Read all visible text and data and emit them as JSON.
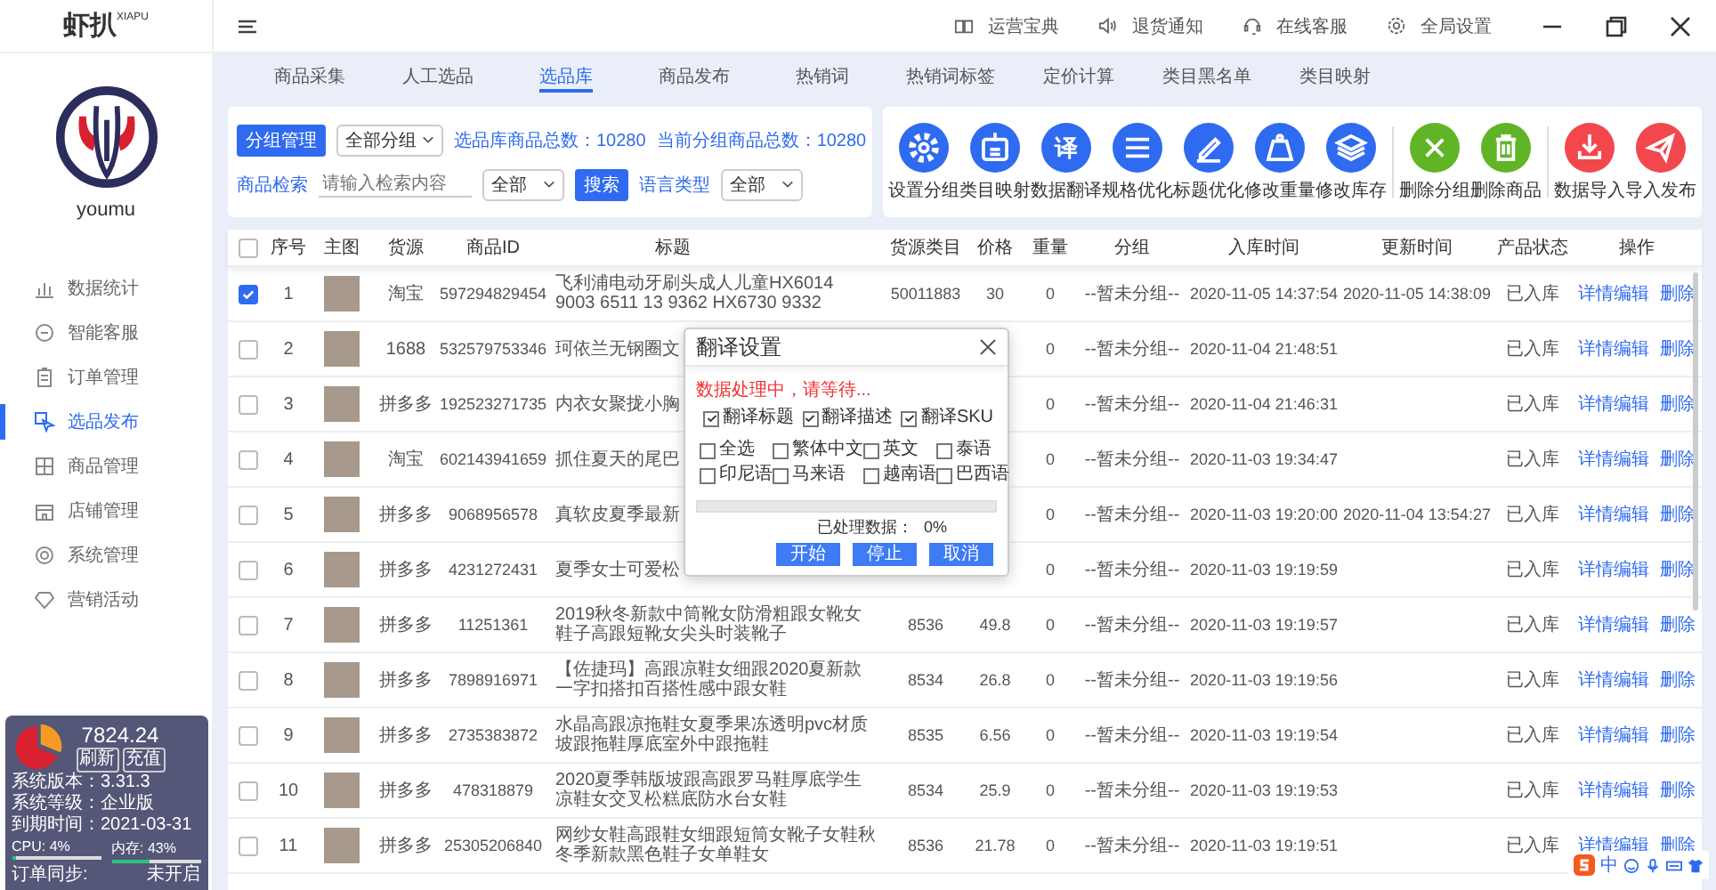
{
  "app": {
    "logo": "虾扒",
    "logo_sup": "XIAPU"
  },
  "header": {
    "links": [
      "运营宝典",
      "退货通知",
      "在线客服",
      "全局设置"
    ]
  },
  "user": {
    "name": "youmu"
  },
  "sidebar": {
    "items": [
      {
        "label": "数据统计",
        "selected": false
      },
      {
        "label": "智能客服",
        "selected": false
      },
      {
        "label": "订单管理",
        "selected": false
      },
      {
        "label": "选品发布",
        "selected": true
      },
      {
        "label": "商品管理",
        "selected": false
      },
      {
        "label": "店铺管理",
        "selected": false
      },
      {
        "label": "系统管理",
        "selected": false
      },
      {
        "label": "营销活动",
        "selected": false
      }
    ]
  },
  "account": {
    "balance": "7824.24",
    "buttons": [
      "刷新",
      "充值"
    ],
    "info": [
      {
        "label": "系统版本",
        "colon": "：",
        "value": "3.31.3"
      },
      {
        "label": "系统等级",
        "colon": "：",
        "value": "企业版"
      },
      {
        "label": "到期时间",
        "colon": "：",
        "value": "2021-03-31"
      }
    ],
    "meters": [
      {
        "label": "CPU: 4%",
        "level": 0.04
      },
      {
        "label": "内存: 43%",
        "level": 0.43
      }
    ],
    "sync": {
      "label": "订单同步:",
      "value": "未开启"
    }
  },
  "tabs": [
    {
      "label": "商品采集",
      "selected": false
    },
    {
      "label": "人工选品",
      "selected": false
    },
    {
      "label": "选品库",
      "selected": true
    },
    {
      "label": "商品发布",
      "selected": false
    },
    {
      "label": "热销词",
      "selected": false
    },
    {
      "label": "热销词标签",
      "selected": false
    },
    {
      "label": "定价计算",
      "selected": false
    },
    {
      "label": "类目黑名单",
      "selected": false
    },
    {
      "label": "类目映射",
      "selected": false
    }
  ],
  "filters": {
    "group_button": "分组管理",
    "group_select": "全部分组",
    "total": "选品库商品总数：10280",
    "group_total": "当前分组商品总数：10280",
    "search_label": "商品检索",
    "search_placeholder": "请输入检索内容",
    "scope_select": "全部",
    "search_button": "搜索",
    "language_label": "语言类型",
    "language_select": "全部"
  },
  "toolbar": {
    "groups": [
      {
        "kind": "edit",
        "tools": [
          {
            "label": "设置分组"
          },
          {
            "label": "类目映射"
          },
          {
            "glyph": "译",
            "label": "数据翻译"
          },
          {
            "label": "规格优化"
          },
          {
            "label": "标题优化"
          },
          {
            "label": "修改重量"
          },
          {
            "label": "修改库存"
          }
        ]
      },
      {
        "kind": "remove",
        "tools": [
          {
            "label": "删除分组"
          },
          {
            "label": "删除商品"
          }
        ]
      },
      {
        "kind": "transfer",
        "tools": [
          {
            "label": "数据导入"
          },
          {
            "label": "导入发布"
          }
        ]
      }
    ]
  },
  "table": {
    "select_all": {
      "checked": false
    },
    "columns": [
      "序号",
      "主图",
      "货源",
      "商品ID",
      "标题",
      "货源类目",
      "价格",
      "重量",
      "分组",
      "入库时间",
      "更新时间",
      "产品状态",
      "操作"
    ],
    "rows": [
      {
        "selected": true,
        "no": "1",
        "source": "淘宝",
        "id": "597294829454",
        "title": "飞利浦电动牙刷头成人儿童HX6014 9003 6511 13 9362 HX6730 9332",
        "category": "50011883",
        "price": "30",
        "weight": "0",
        "group": "--暂未分组--",
        "added": "2020-11-05 14:37:54",
        "updated": "2020-11-05 14:38:09",
        "status": "已入库",
        "actions": [
          "详情编辑",
          "删除"
        ]
      },
      {
        "selected": false,
        "no": "2",
        "source": "1688",
        "id": "532579753346",
        "title": "珂依兰无钢圈文",
        "weight": "0",
        "group": "--暂未分组--",
        "added": "2020-11-04 21:48:51",
        "status": "已入库",
        "actions": [
          "详情编辑",
          "删除"
        ]
      },
      {
        "selected": false,
        "no": "3",
        "source": "拼多多",
        "id": "192523271735",
        "title": "内衣女聚拢小胸",
        "weight": "0",
        "group": "--暂未分组--",
        "added": "2020-11-04 21:46:31",
        "status": "已入库",
        "actions": [
          "详情编辑",
          "删除"
        ]
      },
      {
        "selected": false,
        "no": "4",
        "source": "淘宝",
        "id": "602143941659",
        "title": "抓住夏天的尾巴",
        "weight": "0",
        "group": "--暂未分组--",
        "added": "2020-11-03 19:34:47",
        "status": "已入库",
        "actions": [
          "详情编辑",
          "删除"
        ]
      },
      {
        "selected": false,
        "no": "5",
        "source": "拼多多",
        "id": "9068956578",
        "title": "真软皮夏季最新",
        "weight": "0",
        "group": "--暂未分组--",
        "added": "2020-11-03 19:20:00",
        "updated": "2020-11-04 13:54:27",
        "status": "已入库",
        "actions": [
          "详情编辑",
          "删除"
        ]
      },
      {
        "selected": false,
        "no": "6",
        "source": "拼多多",
        "id": "4231272431",
        "title": "夏季女士可爱松",
        "weight": "0",
        "group": "--暂未分组--",
        "added": "2020-11-03 19:19:59",
        "status": "已入库",
        "actions": [
          "详情编辑",
          "删除"
        ]
      },
      {
        "selected": false,
        "no": "7",
        "source": "拼多多",
        "id": "11251361",
        "title": "2019秋冬新款中筒靴女防滑粗跟女靴女鞋子高跟短靴女尖头时装靴子",
        "category": "8536",
        "price": "49.8",
        "weight": "0",
        "group": "--暂未分组--",
        "added": "2020-11-03 19:19:57",
        "status": "已入库",
        "actions": [
          "详情编辑",
          "删除"
        ]
      },
      {
        "selected": false,
        "no": "8",
        "source": "拼多多",
        "id": "7898916971",
        "title": "【佐捷玛】高跟凉鞋女细跟2020夏新款一字扣搭扣百搭性感中跟女鞋",
        "category": "8534",
        "price": "26.8",
        "weight": "0",
        "group": "--暂未分组--",
        "added": "2020-11-03 19:19:56",
        "status": "已入库",
        "actions": [
          "详情编辑",
          "删除"
        ]
      },
      {
        "selected": false,
        "no": "9",
        "source": "拼多多",
        "id": "2735383872",
        "title": "水晶高跟凉拖鞋女夏季果冻透明pvc材质坡跟拖鞋厚底室外中跟拖鞋",
        "category": "8535",
        "price": "6.56",
        "weight": "0",
        "group": "--暂未分组--",
        "added": "2020-11-03 19:19:54",
        "status": "已入库",
        "actions": [
          "详情编辑",
          "删除"
        ]
      },
      {
        "selected": false,
        "no": "10",
        "source": "拼多多",
        "id": "478318879",
        "title": "2020夏季韩版坡跟高跟罗马鞋厚底学生凉鞋女交叉松糕底防水台女鞋",
        "category": "8534",
        "price": "25.9",
        "weight": "0",
        "group": "--暂未分组--",
        "added": "2020-11-03 19:19:53",
        "status": "已入库",
        "actions": [
          "详情编辑",
          "删除"
        ]
      },
      {
        "selected": false,
        "no": "11",
        "source": "拼多多",
        "id": "25305206840",
        "title": "网纱女鞋高跟鞋女细跟短筒女靴子女鞋秋冬季新款黑色鞋子女单鞋女",
        "category": "8536",
        "price": "21.78",
        "weight": "0",
        "group": "--暂未分组--",
        "added": "2020-11-03 19:19:51",
        "status": "已入库",
        "actions": [
          "详情编辑",
          "删除"
        ]
      }
    ]
  },
  "dialog": {
    "title": "翻译设置",
    "message": "数据处理中，请等待...",
    "options": [
      {
        "label": "翻译标题",
        "checked": true
      },
      {
        "label": "翻译描述",
        "checked": true
      },
      {
        "label": "翻译SKU",
        "checked": true
      }
    ],
    "languages": [
      {
        "label": "全选",
        "checked": false
      },
      {
        "label": "繁体中文",
        "checked": false
      },
      {
        "label": "英文",
        "checked": false
      },
      {
        "label": "泰语",
        "checked": false
      },
      {
        "label": "印尼语",
        "checked": false
      },
      {
        "label": "马来语",
        "checked": false
      },
      {
        "label": "越南语",
        "checked": false
      },
      {
        "label": "巴西语",
        "checked": false
      }
    ],
    "progress": {
      "level": 0,
      "label": "已处理数据：",
      "value": "0%"
    },
    "buttons": [
      "开始",
      "停止",
      "取消"
    ]
  },
  "ime": {
    "label": "中"
  }
}
